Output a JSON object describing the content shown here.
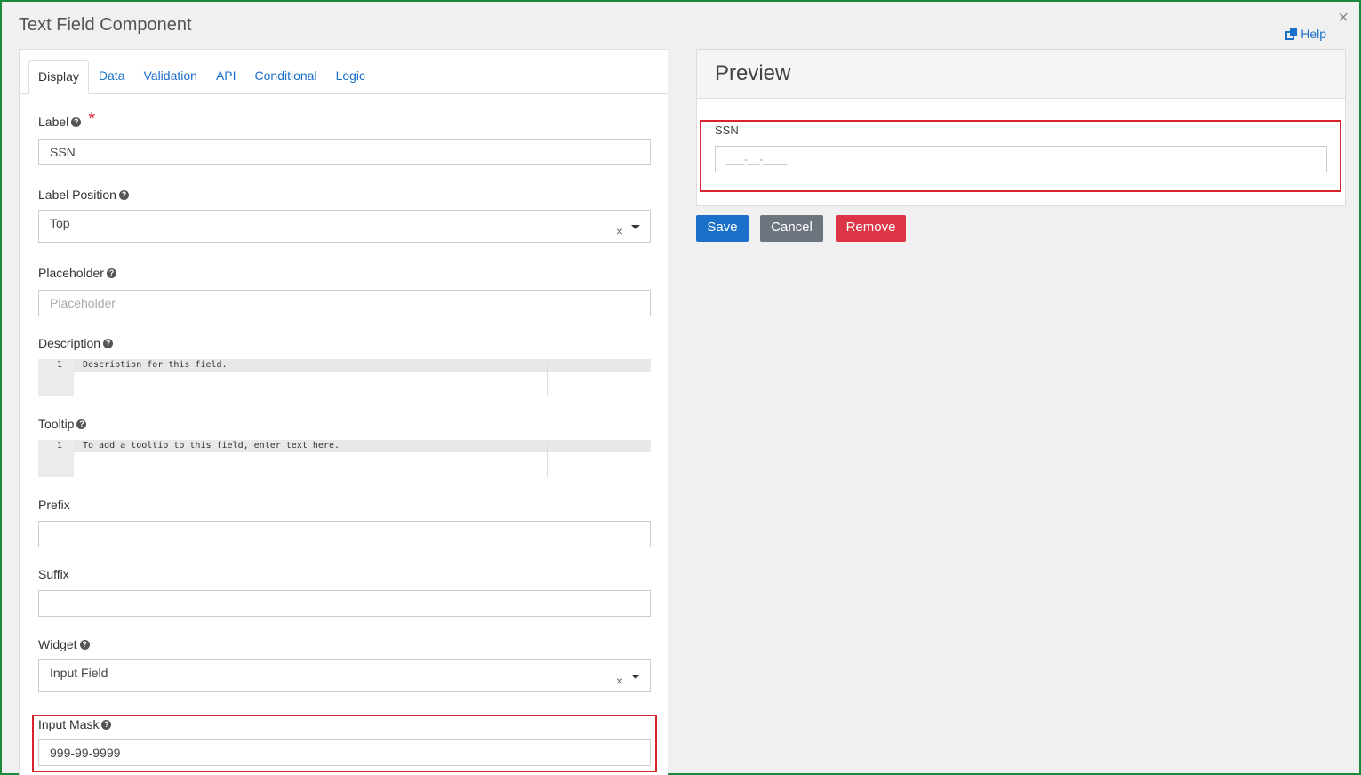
{
  "dialog": {
    "title": "Text Field Component",
    "close": "×",
    "help": "Help"
  },
  "tabs": [
    {
      "label": "Display"
    },
    {
      "label": "Data"
    },
    {
      "label": "Validation"
    },
    {
      "label": "API"
    },
    {
      "label": "Conditional"
    },
    {
      "label": "Logic"
    }
  ],
  "form": {
    "label": {
      "label": "Label",
      "value": "SSN",
      "required": "*"
    },
    "label_position": {
      "label": "Label Position",
      "value": "Top",
      "clear": "×"
    },
    "placeholder": {
      "label": "Placeholder",
      "placeholder": "Placeholder"
    },
    "description": {
      "label": "Description",
      "line_number": "1",
      "text": "Description for this field."
    },
    "tooltip": {
      "label": "Tooltip",
      "line_number": "1",
      "text": "To add a tooltip to this field, enter text here."
    },
    "prefix": {
      "label": "Prefix",
      "value": ""
    },
    "suffix": {
      "label": "Suffix",
      "value": ""
    },
    "widget": {
      "label": "Widget",
      "value": "Input Field",
      "clear": "×"
    },
    "input_mask": {
      "label": "Input Mask",
      "value": "999-99-9999"
    }
  },
  "preview": {
    "title": "Preview",
    "field_label": "SSN",
    "field_mask": "___-__-____"
  },
  "buttons": {
    "save": "Save",
    "cancel": "Cancel",
    "remove": "Remove"
  },
  "colors": {
    "accent": "#1a6fc9",
    "highlight": "#d9232f",
    "remove": "#dc3545",
    "cancel": "#6c757d",
    "window_border": "#1a8a3a"
  }
}
